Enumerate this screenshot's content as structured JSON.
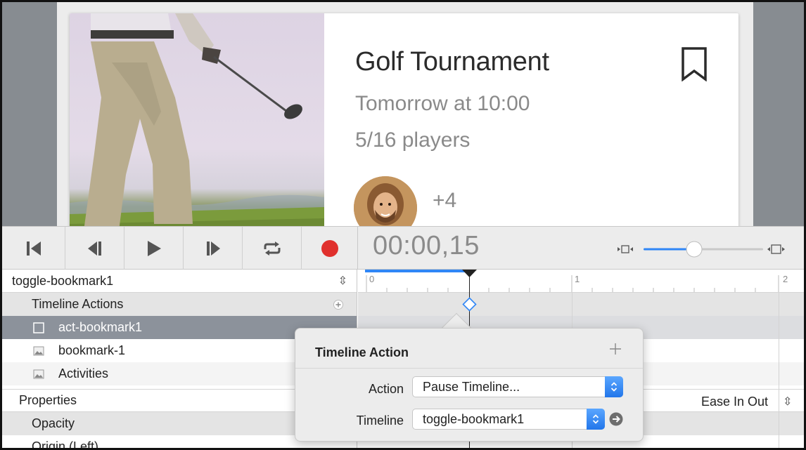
{
  "preview": {
    "card": {
      "title": "Golf Tournament",
      "when": "Tomorrow at 10:00",
      "players": "5/16 players",
      "more_count": "+4"
    }
  },
  "transport": {
    "time": "00:00,15",
    "buttons": [
      "skip-to-start-icon",
      "step-back-icon",
      "play-icon",
      "step-forward-icon",
      "loop-icon",
      "record-icon"
    ],
    "zoom_level": 0.3,
    "colors": {
      "record": "#e0302d",
      "accent": "#2f86f6"
    }
  },
  "timeline_selector": {
    "value": "toggle-bookmark1"
  },
  "list": {
    "timeline_actions": "Timeline Actions",
    "items": [
      {
        "label": "act-bookmark1",
        "icon": "rectangle-icon"
      },
      {
        "label": "bookmark-1",
        "icon": "image-icon"
      },
      {
        "label": "Activities",
        "icon": "image-icon"
      }
    ],
    "properties": "Properties",
    "property_rows": [
      "Opacity",
      "Origin (Left)"
    ]
  },
  "ruler": {
    "labels": [
      "0",
      "1",
      "2"
    ],
    "playhead_fraction": 0.5
  },
  "easing": {
    "value": "Ease In Out"
  },
  "popover": {
    "title": "Timeline Action",
    "action_label": "Action",
    "action_value": "Pause Timeline...",
    "timeline_label": "Timeline",
    "timeline_value": "toggle-bookmark1"
  }
}
